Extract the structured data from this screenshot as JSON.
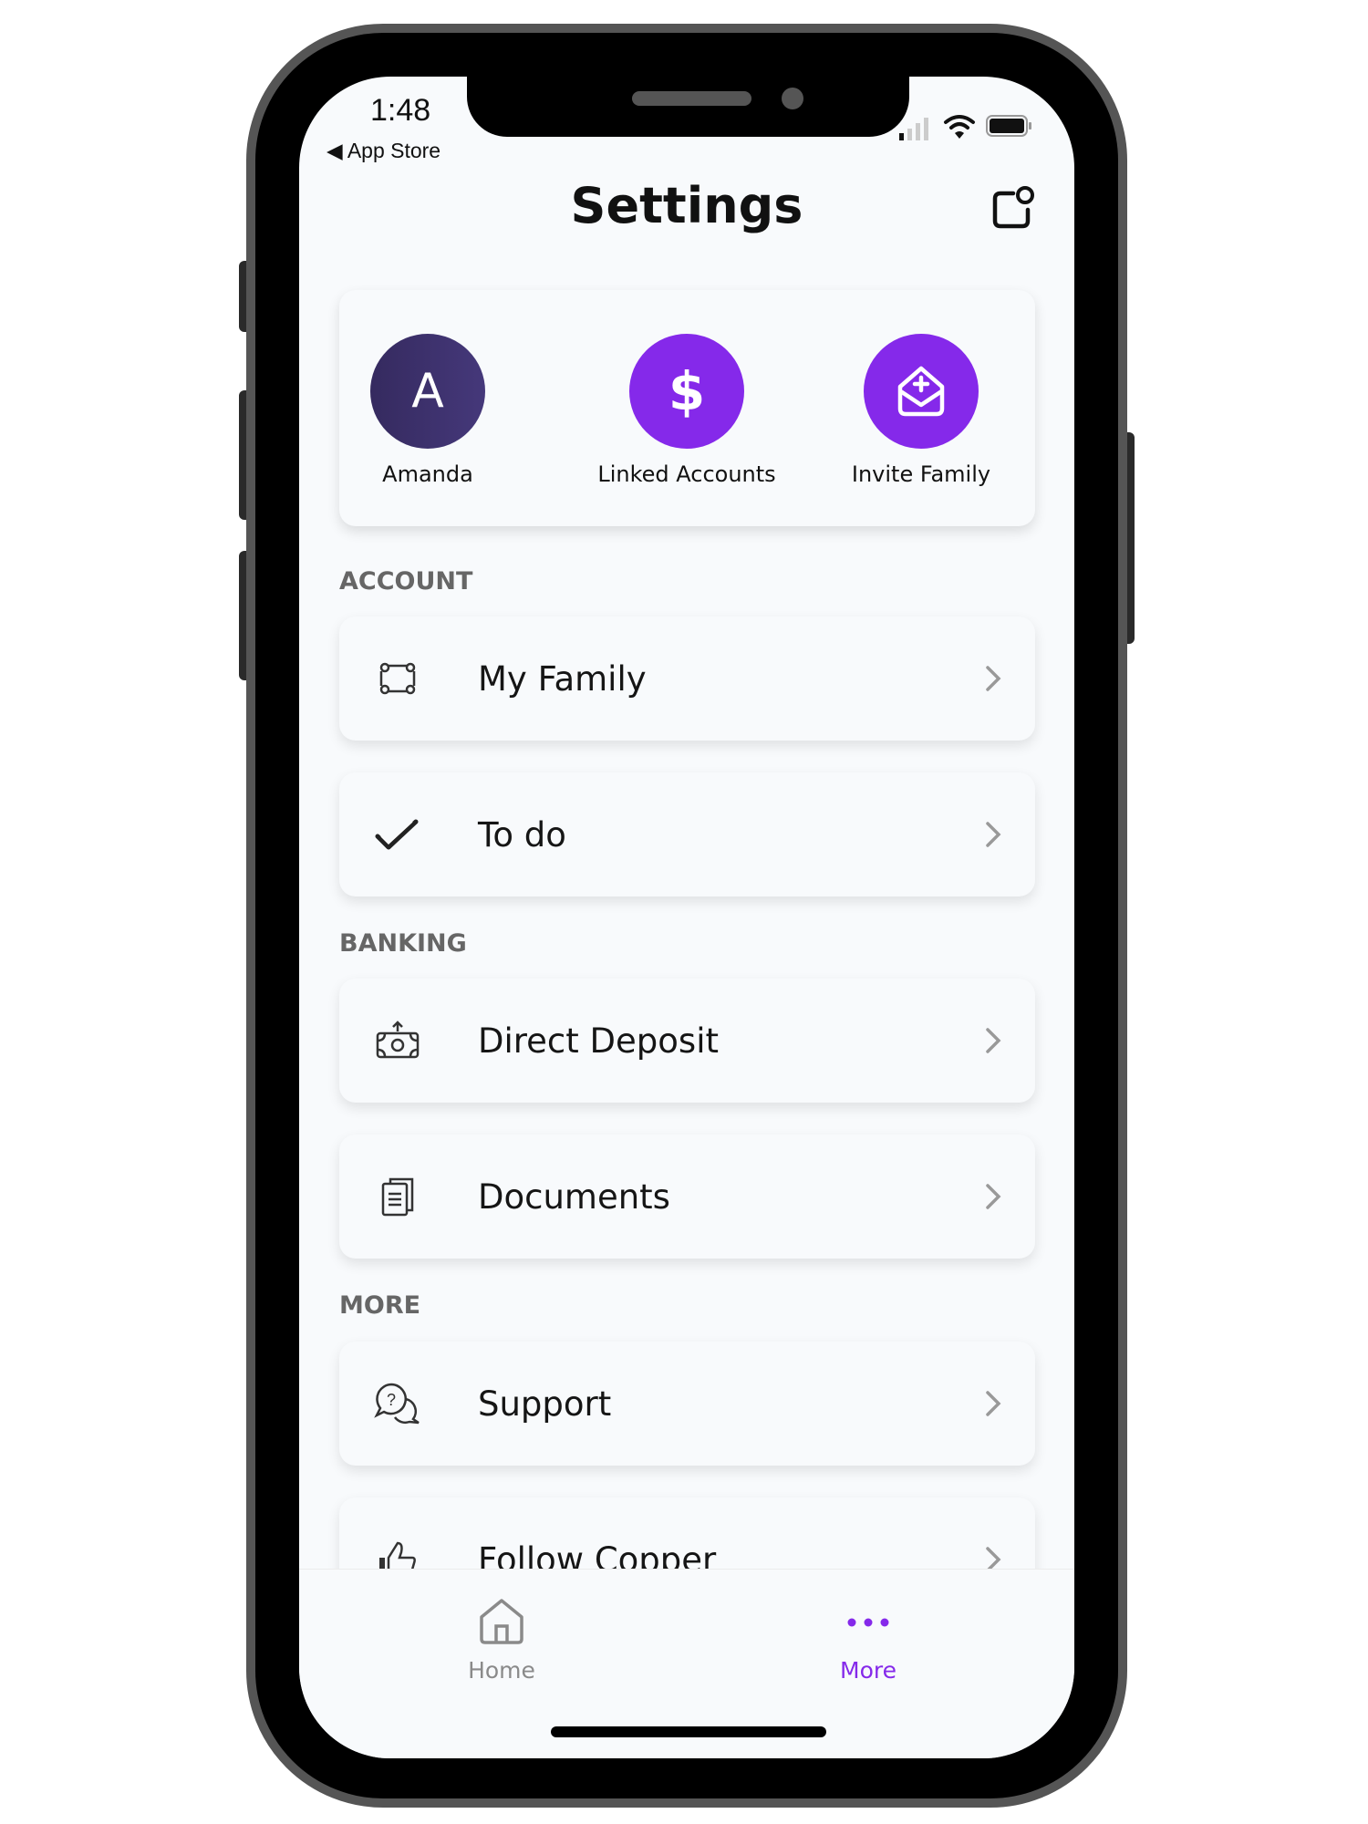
{
  "status_bar": {
    "time": "1:48",
    "back_label": "App Store"
  },
  "header": {
    "title": "Settings",
    "share_icon": "share-square-icon"
  },
  "shortcuts": [
    {
      "label": "Amanda",
      "initial": "A",
      "icon": "avatar",
      "color": "#3d2f6b"
    },
    {
      "label": "Linked Accounts",
      "glyph": "$",
      "icon": "dollar-icon",
      "color": "#8529ea"
    },
    {
      "label": "Invite Family",
      "icon": "invite-mail-icon",
      "color": "#8529ea"
    }
  ],
  "sections": {
    "account": "ACCOUNT",
    "banking": "BANKING",
    "more": "MORE"
  },
  "rows": [
    {
      "label": "My Family",
      "icon": "family-frame-icon"
    },
    {
      "label": "To do",
      "icon": "checkmark-icon"
    },
    {
      "label": "Direct Deposit",
      "icon": "cash-deposit-icon"
    },
    {
      "label": "Documents",
      "icon": "documents-icon"
    },
    {
      "label": "Support",
      "icon": "support-chat-icon"
    },
    {
      "label": "Follow Copper",
      "icon": "thumbs-up-icon"
    }
  ],
  "tabbar": {
    "tabs": [
      {
        "label": "Home",
        "icon": "home-icon",
        "active": false
      },
      {
        "label": "More",
        "icon": "more-dots-icon",
        "active": true
      }
    ],
    "active_color": "#8529ea",
    "inactive_color": "#8a8a8a"
  }
}
